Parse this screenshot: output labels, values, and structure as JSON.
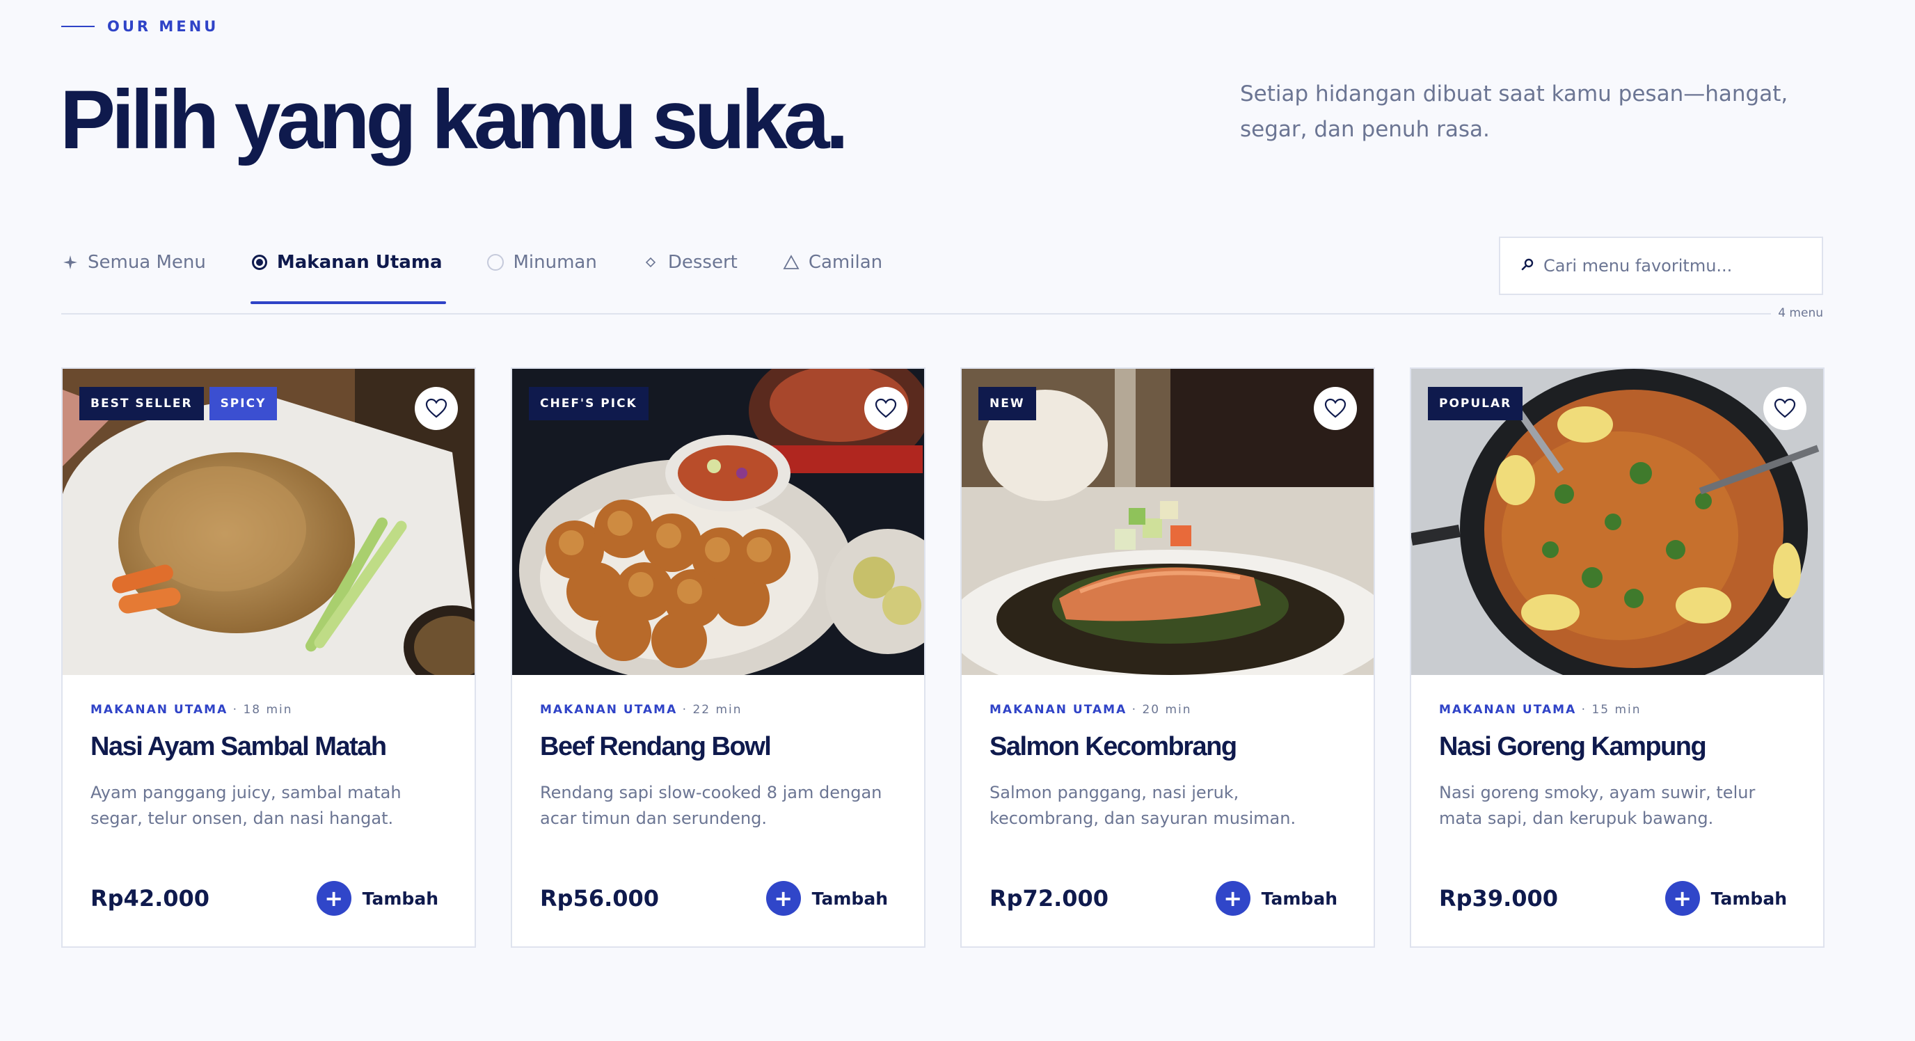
{
  "header": {
    "eyebrow": "OUR MENU",
    "title": "Pilih yang kamu suka.",
    "subtitle": "Setiap hidangan dibuat saat kamu pesan—hangat, segar, dan penuh rasa."
  },
  "tabs": [
    {
      "label": "Semua Menu",
      "icon": "sparkle-icon"
    },
    {
      "label": "Makanan Utama",
      "icon": "radio-selected-icon",
      "active": true
    },
    {
      "label": "Minuman",
      "icon": "circle-icon"
    },
    {
      "label": "Dessert",
      "icon": "diamond-icon"
    },
    {
      "label": "Camilan",
      "icon": "triangle-icon"
    }
  ],
  "search": {
    "placeholder": "Cari menu favoritmu...",
    "icon": "search-icon"
  },
  "result_count": "4 menu",
  "colors": {
    "accent": "#2f43c7",
    "navy": "#0f1a4d",
    "muted": "#6b7593",
    "background": "#f8f9fd"
  },
  "cards": [
    {
      "badges": [
        "BEST SELLER",
        "SPICY"
      ],
      "category": "MAKANAN UTAMA",
      "time": "· 18 min",
      "name": "Nasi Ayam Sambal Matah",
      "description": "Ayam panggang juicy, sambal matah segar, telur onsen, dan nasi hangat.",
      "price": "Rp42.000",
      "add_label": "Tambah",
      "image": "fried-rice-plate-photo"
    },
    {
      "badges": [
        "CHEF'S PICK"
      ],
      "category": "MAKANAN UTAMA",
      "time": "· 22 min",
      "name": "Beef Rendang Bowl",
      "description": "Rendang sapi slow-cooked 8 jam dengan acar timun dan serundeng.",
      "price": "Rp56.000",
      "add_label": "Tambah",
      "image": "bread-rolls-curry-photo"
    },
    {
      "badges": [
        "NEW"
      ],
      "category": "MAKANAN UTAMA",
      "time": "· 20 min",
      "name": "Salmon Kecombrang",
      "description": "Salmon panggang, nasi jeruk, kecombrang, dan sayuran musiman.",
      "price": "Rp72.000",
      "add_label": "Tambah",
      "image": "salmon-plate-photo"
    },
    {
      "badges": [
        "POPULAR"
      ],
      "category": "MAKANAN UTAMA",
      "time": "· 15 min",
      "name": "Nasi Goreng Kampung",
      "description": "Nasi goreng smoky, ayam suwir, telur mata sapi, dan kerupuk bawang.",
      "price": "Rp39.000",
      "add_label": "Tambah",
      "image": "paella-pan-photo"
    }
  ]
}
